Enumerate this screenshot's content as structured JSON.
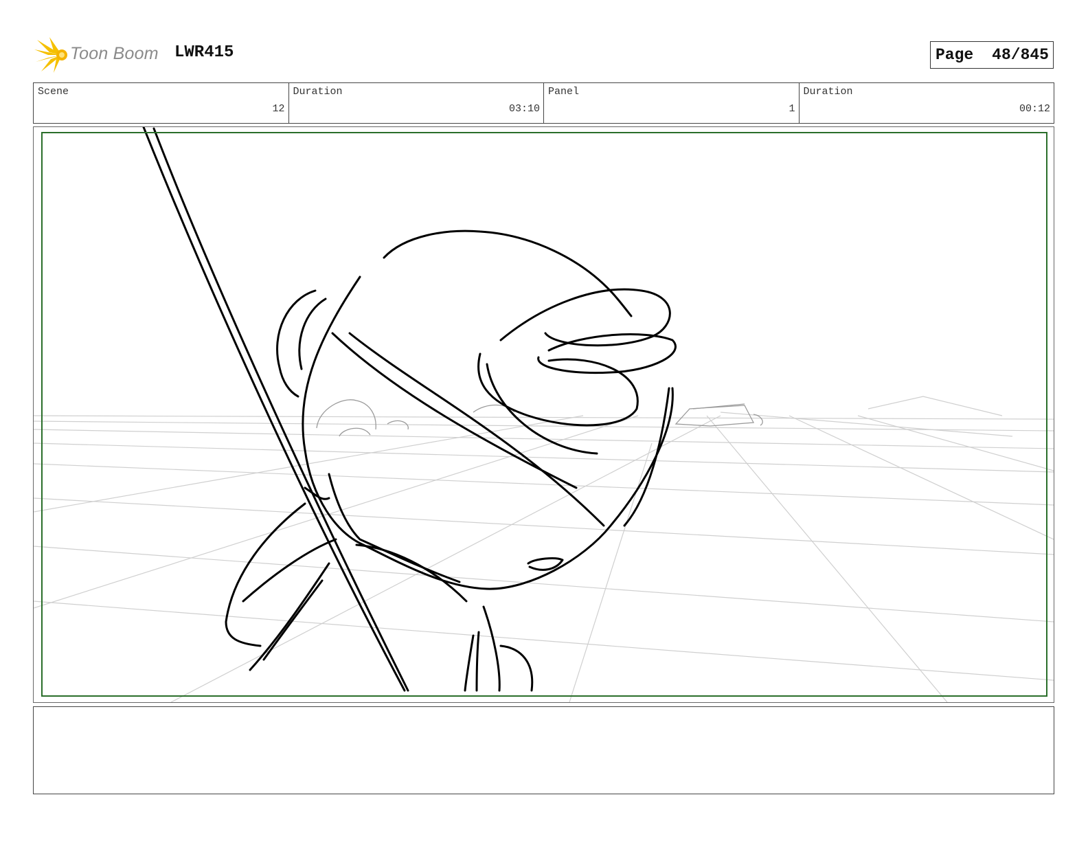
{
  "header": {
    "logo_text": "Toon Boom",
    "project_code": "LWR415",
    "page_label": "Page",
    "page_number": "48/845"
  },
  "info": {
    "scene_label": "Scene",
    "scene_value": "12",
    "scene_duration_label": "Duration",
    "scene_duration_value": "03:10",
    "panel_label": "Panel",
    "panel_value": "1",
    "panel_duration_label": "Duration",
    "panel_duration_value": "00:12"
  },
  "panel": {
    "safe_frame_color": "#2a6e2a",
    "sketch_color": "#000000",
    "grid_color": "#cccccc"
  },
  "notes": {
    "text": ""
  }
}
